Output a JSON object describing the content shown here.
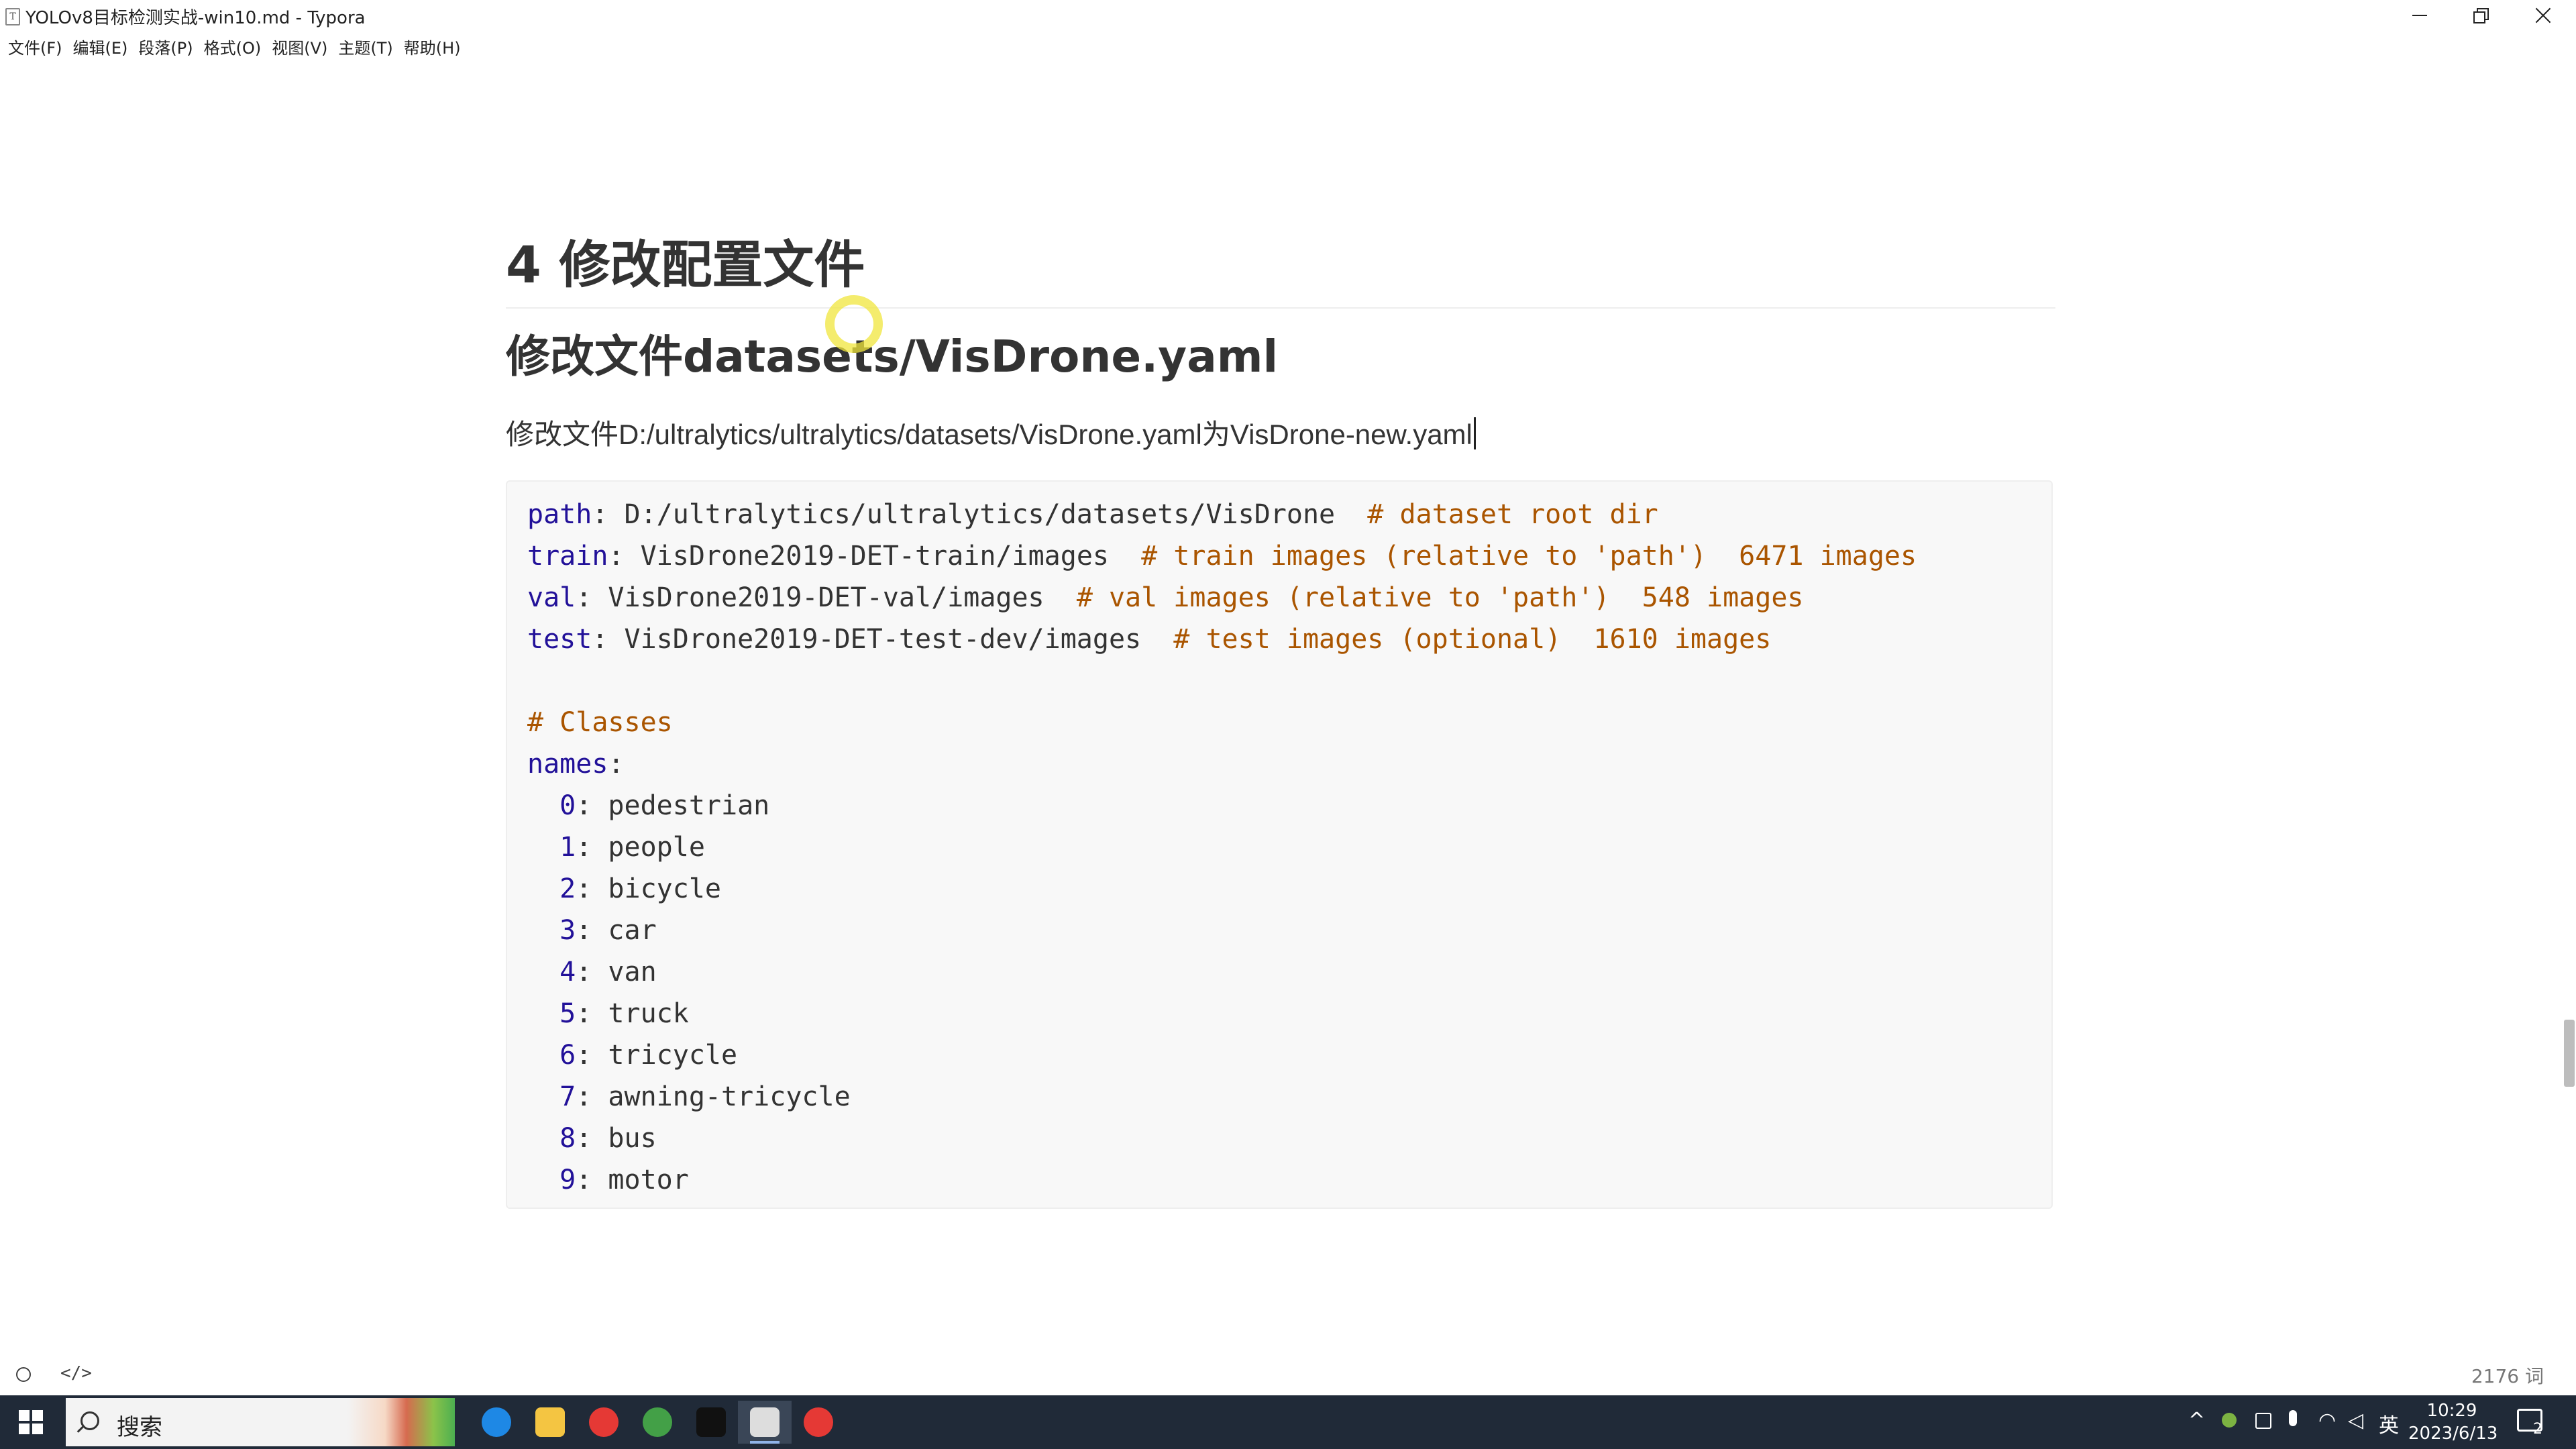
{
  "window": {
    "title": "YOLOv8目标检测实战-win10.md - Typora",
    "app_icon_glyph": "T"
  },
  "menu": [
    "文件(F)",
    "编辑(E)",
    "段落(P)",
    "格式(O)",
    "视图(V)",
    "主题(T)",
    "帮助(H)"
  ],
  "document": {
    "h1": "4 修改配置文件",
    "h2": "修改文件datasets/VisDrone.yaml",
    "paragraph": "修改文件D:/ultralytics/ultralytics/datasets/VisDrone.yaml为VisDrone-new.yaml",
    "code_lines": [
      {
        "key": "path",
        "value": " D:/ultralytics/ultralytics/datasets/VisDrone  ",
        "comment": "# dataset root dir"
      },
      {
        "key": "train",
        "value": " VisDrone2019-DET-train/images  ",
        "comment": "# train images (relative to 'path')  6471 images"
      },
      {
        "key": "val",
        "value": " VisDrone2019-DET-val/images  ",
        "comment": "# val images (relative to 'path')  548 images"
      },
      {
        "key": "test",
        "value": " VisDrone2019-DET-test-dev/images  ",
        "comment": "# test images (optional)  1610 images"
      },
      {
        "key": "",
        "value": "",
        "comment": ""
      },
      {
        "key": "",
        "value": "",
        "comment": "# Classes"
      },
      {
        "key": "names",
        "value": "",
        "comment": ""
      },
      {
        "key": "  0",
        "value": " pedestrian",
        "comment": ""
      },
      {
        "key": "  1",
        "value": " people",
        "comment": ""
      },
      {
        "key": "  2",
        "value": " bicycle",
        "comment": ""
      },
      {
        "key": "  3",
        "value": " car",
        "comment": ""
      },
      {
        "key": "  4",
        "value": " van",
        "comment": ""
      },
      {
        "key": "  5",
        "value": " truck",
        "comment": ""
      },
      {
        "key": "  6",
        "value": " tricycle",
        "comment": ""
      },
      {
        "key": "  7",
        "value": " awning-tricycle",
        "comment": ""
      },
      {
        "key": "  8",
        "value": " bus",
        "comment": ""
      },
      {
        "key": "  9",
        "value": " motor",
        "comment": ""
      }
    ]
  },
  "statusbar": {
    "source_toggle": "</>",
    "word_count": "2176 词"
  },
  "taskbar": {
    "search_label": "搜索",
    "apps": [
      {
        "name": "edge",
        "color": "#1e88e5",
        "active": false
      },
      {
        "name": "file-explorer",
        "color": "#f4c542",
        "active": false
      },
      {
        "name": "chrome",
        "color": "#e53935",
        "active": false
      },
      {
        "name": "browser-green",
        "color": "#43a047",
        "active": false
      },
      {
        "name": "terminal",
        "color": "#111111",
        "active": false
      },
      {
        "name": "typora",
        "color": "#dddddd",
        "active": true
      },
      {
        "name": "screen-recorder",
        "color": "#e53935",
        "active": false
      }
    ],
    "tray": {
      "ime": "英",
      "time": "10:29",
      "date": "2023/6/13",
      "notifications": "2"
    }
  },
  "colors": {
    "code_key": "#221199",
    "code_comment": "#aa5500",
    "taskbar_bg": "#202a38"
  }
}
